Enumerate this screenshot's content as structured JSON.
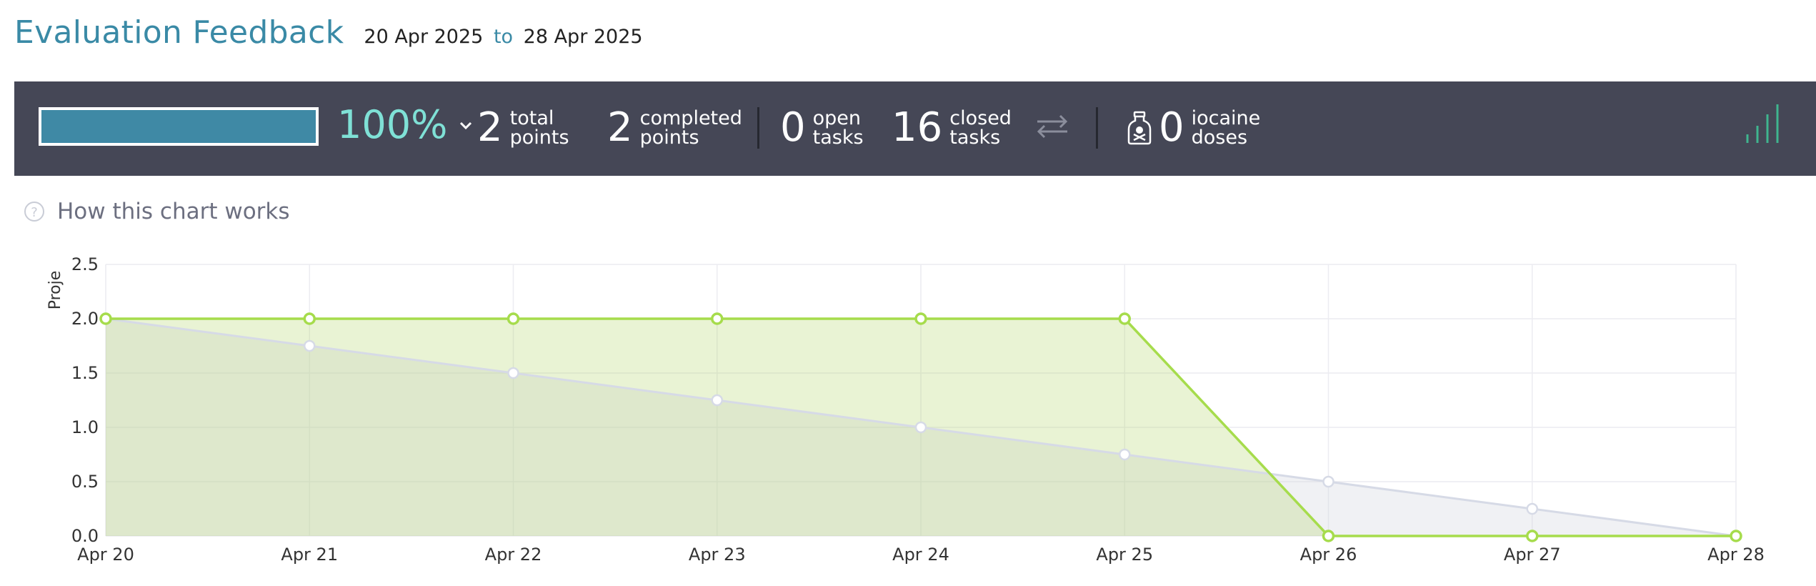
{
  "header": {
    "title": "Evaluation Feedback",
    "date_from": "20 Apr 2025",
    "date_to_word": "to",
    "date_to": "28 Apr 2025"
  },
  "stats": {
    "progress_fraction": 1.0,
    "percent_label": "100%",
    "total_points": "2",
    "total_points_label": [
      "total",
      "points"
    ],
    "completed_points": "2",
    "completed_points_label": [
      "completed",
      "points"
    ],
    "open_tasks": "0",
    "open_tasks_label": [
      "open",
      "tasks"
    ],
    "closed_tasks": "16",
    "closed_tasks_label": [
      "closed",
      "tasks"
    ],
    "iocaine_doses": "0",
    "iocaine_doses_label": [
      "iocaine",
      "doses"
    ]
  },
  "icons": {
    "expand": "chevron-down-icon",
    "swap": "swap-arrows-icon",
    "bottle": "poison-bottle-icon",
    "chart_toggle": "bar-chart-icon",
    "help": "question-circle-icon"
  },
  "help_link": {
    "icon_glyph": "?",
    "label": "How this chart works"
  },
  "colors": {
    "brand": "#3a8aa6",
    "bar_bg": "#454756",
    "percent": "#7fe1d6",
    "actual_line": "#a6dc4c",
    "ideal_line": "#d6dae6",
    "chart_toggle": "#3fb58f"
  },
  "chart_data": {
    "type": "area",
    "ylabel": "Proje",
    "categories": [
      "Apr 20",
      "Apr 21",
      "Apr 22",
      "Apr 23",
      "Apr 24",
      "Apr 25",
      "Apr 26",
      "Apr 27",
      "Apr 28"
    ],
    "ylim": [
      0,
      2.5
    ],
    "yticks": [
      "0.0",
      "0.5",
      "1.0",
      "1.5",
      "2.0",
      "2.5"
    ],
    "grid": true,
    "series": [
      {
        "key": "ideal",
        "values": [
          2.0,
          1.75,
          1.5,
          1.25,
          1.0,
          0.75,
          0.5,
          0.25,
          0.0
        ]
      },
      {
        "key": "actual",
        "values": [
          2.0,
          2.0,
          2.0,
          2.0,
          2.0,
          2.0,
          0.0,
          0.0,
          0.0
        ]
      }
    ]
  }
}
